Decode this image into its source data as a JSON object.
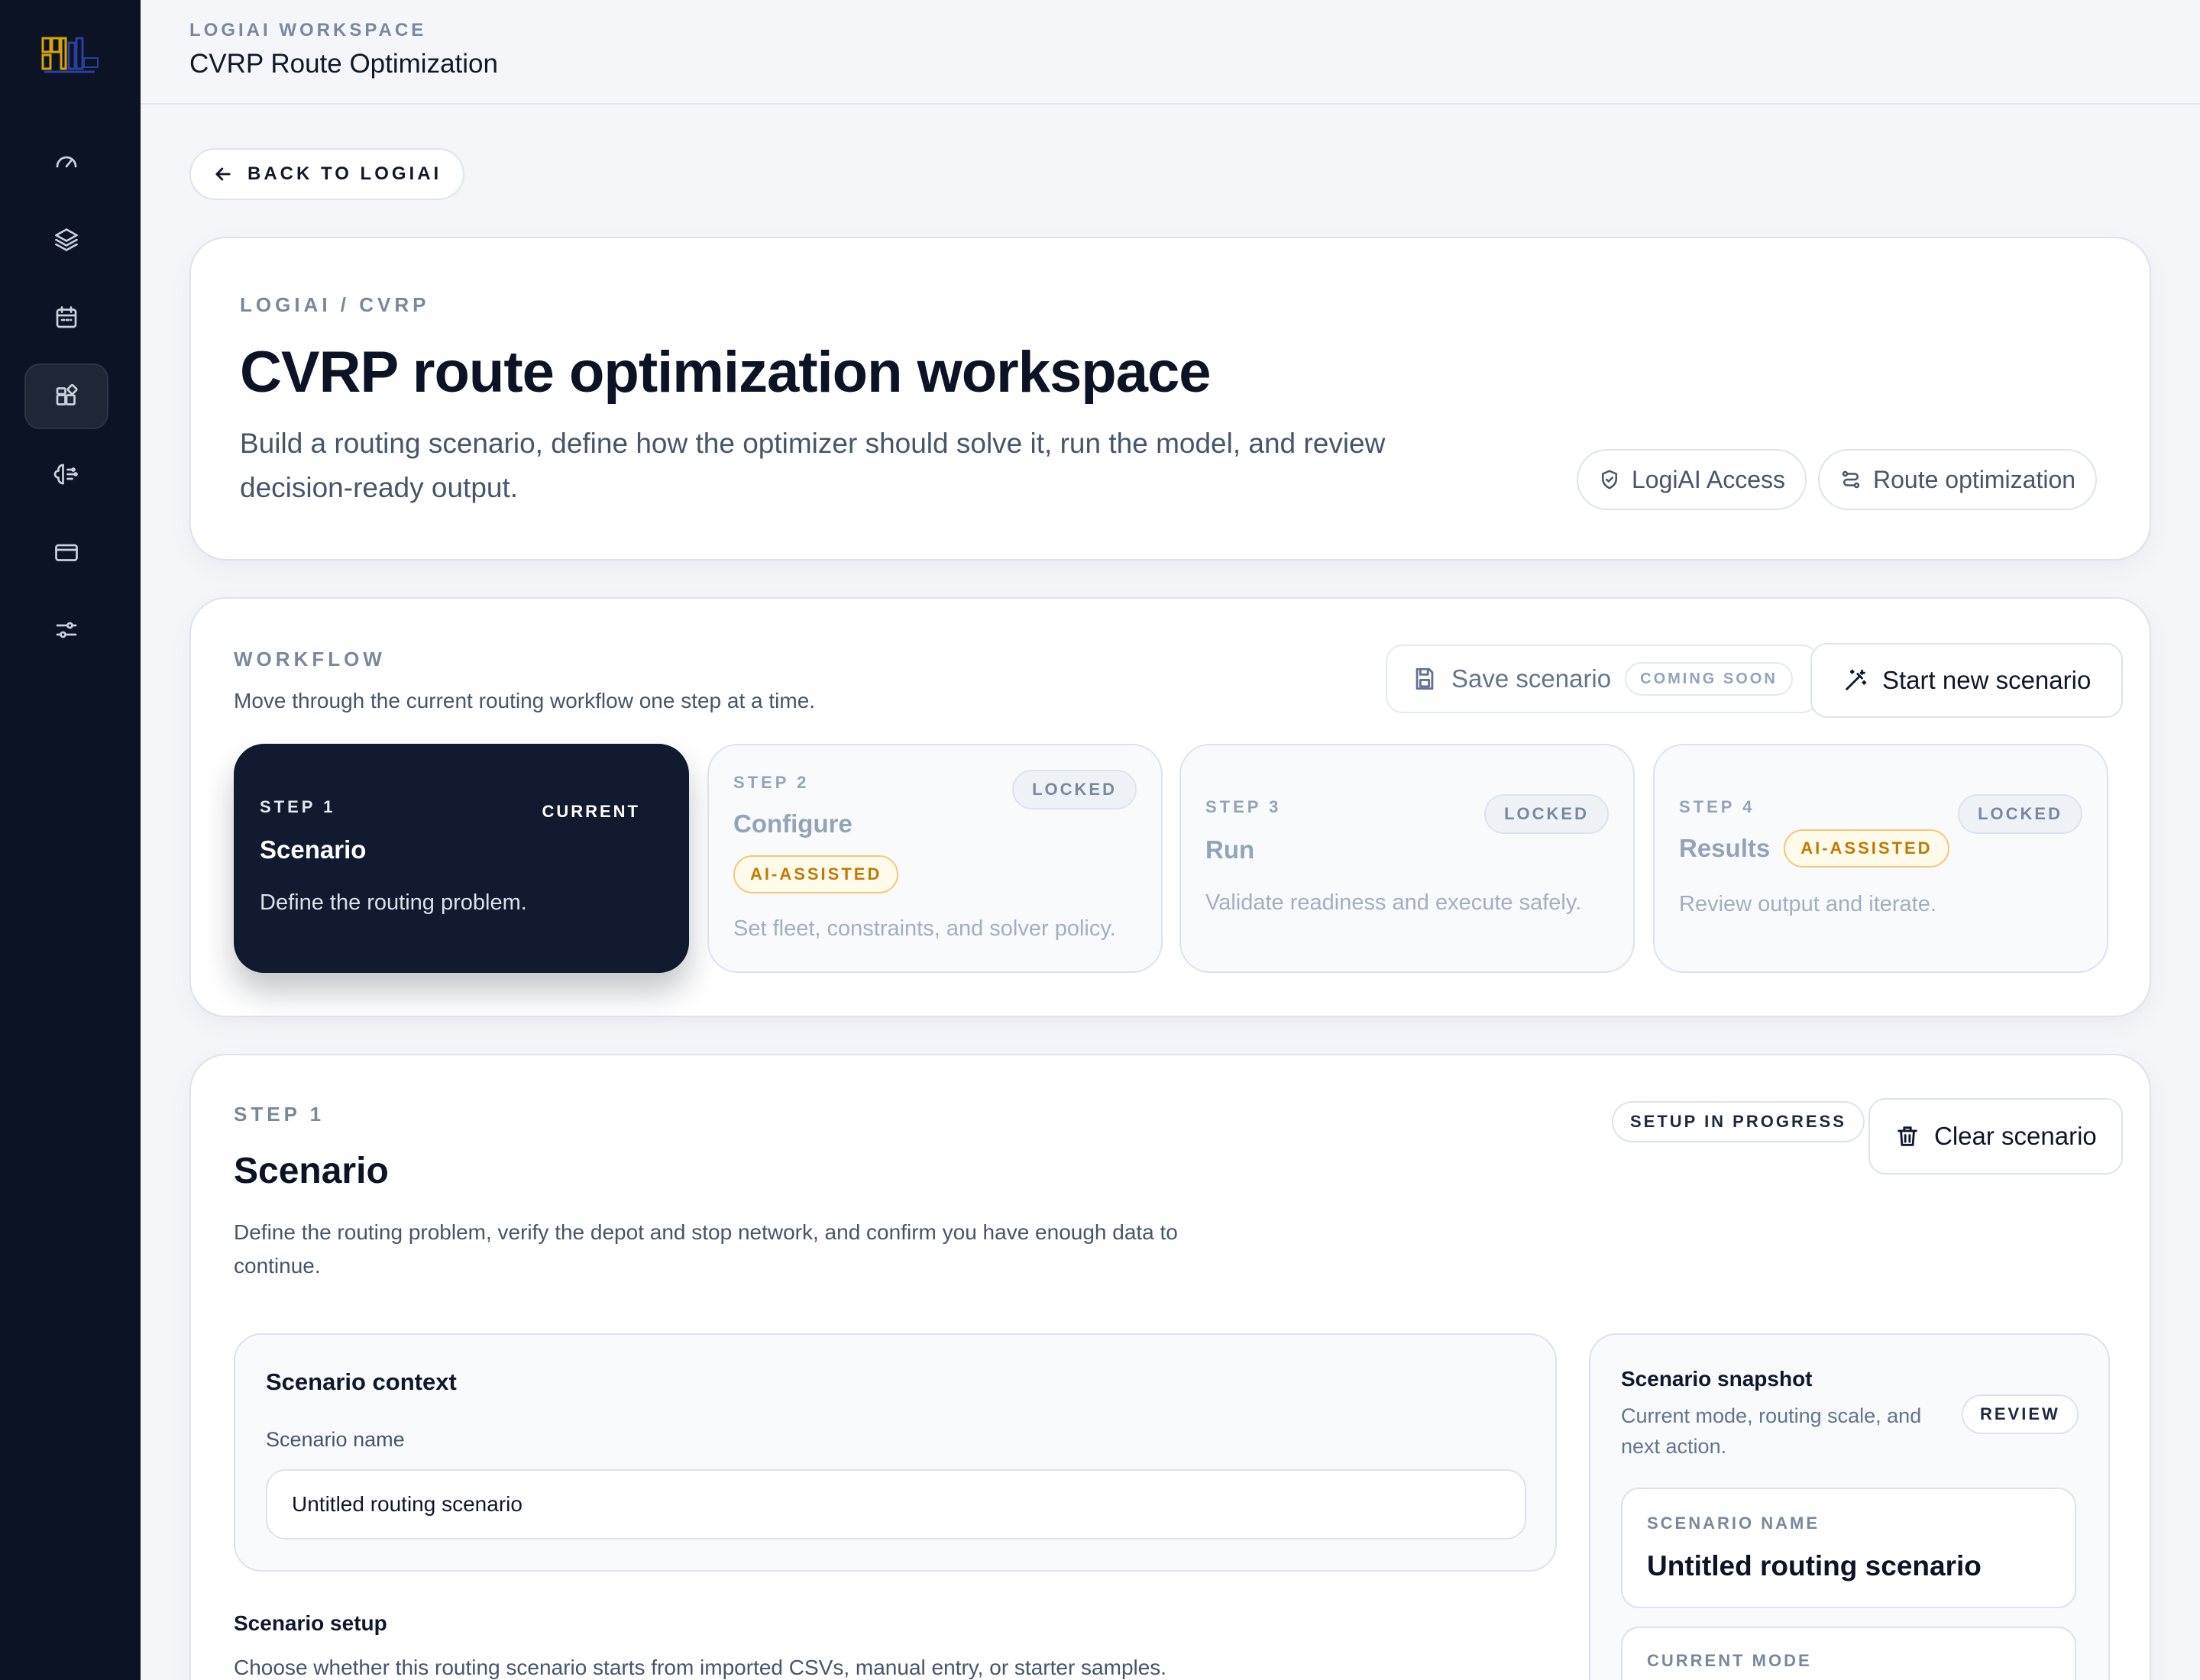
{
  "sidebar": {
    "logo": "app-logo",
    "items": [
      {
        "icon": "gauge-icon"
      },
      {
        "icon": "layers-icon"
      },
      {
        "icon": "calendar-icon"
      },
      {
        "icon": "widgets-icon",
        "active": true
      },
      {
        "icon": "brain-icon"
      },
      {
        "icon": "card-icon"
      },
      {
        "icon": "sliders-icon"
      }
    ]
  },
  "header": {
    "workspace_label": "LOGIAI WORKSPACE",
    "title": "CVRP Route Optimization"
  },
  "back_button": {
    "label": "BACK TO LOGIAI"
  },
  "hero": {
    "breadcrumb": "LOGIAI / CVRP",
    "title": "CVRP route optimization workspace",
    "description": "Build a routing scenario, define how the optimizer should solve it, run the model, and review decision-ready output.",
    "pills": [
      {
        "label": "LogiAI Access",
        "icon": "shield-check-icon"
      },
      {
        "label": "Route optimization",
        "icon": "route-icon"
      }
    ]
  },
  "workflow": {
    "label": "WORKFLOW",
    "subtitle": "Move through the current routing workflow one step at a time.",
    "save_button": "Save scenario",
    "save_badge": "COMING SOON",
    "new_button": "Start new scenario",
    "steps": [
      {
        "num": "STEP 1",
        "name": "Scenario",
        "desc": "Define the routing problem.",
        "badge": "CURRENT"
      },
      {
        "num": "STEP 2",
        "name": "Configure",
        "desc": "Set fleet, constraints, and solver policy.",
        "badge": "LOCKED",
        "ai": "AI-ASSISTED"
      },
      {
        "num": "STEP 3",
        "name": "Run",
        "desc": "Validate readiness and execute safely.",
        "badge": "LOCKED"
      },
      {
        "num": "STEP 4",
        "name": "Results",
        "desc": "Review output and iterate.",
        "badge": "LOCKED",
        "ai": "AI-ASSISTED"
      }
    ]
  },
  "step_panel": {
    "label": "STEP 1",
    "title": "Scenario",
    "description": "Define the routing problem, verify the depot and stop network, and confirm you have enough data to continue.",
    "status": "SETUP IN PROGRESS",
    "clear_button": "Clear scenario",
    "context": {
      "title": "Scenario context",
      "name_label": "Scenario name",
      "name_value": "Untitled routing scenario"
    },
    "setup": {
      "title": "Scenario setup",
      "description": "Choose whether this routing scenario starts from imported CSVs, manual entry, or starter samples."
    },
    "snapshot": {
      "title": "Scenario snapshot",
      "subtitle": "Current mode, routing scale, and next action.",
      "badge": "REVIEW",
      "name_label": "SCENARIO NAME",
      "name_value": "Untitled routing scenario",
      "mode_label": "CURRENT MODE"
    }
  },
  "colors": {
    "sidebar_bg": "#0b1324",
    "current_step_bg": "#111a2e",
    "ai_badge": "#c27803"
  }
}
